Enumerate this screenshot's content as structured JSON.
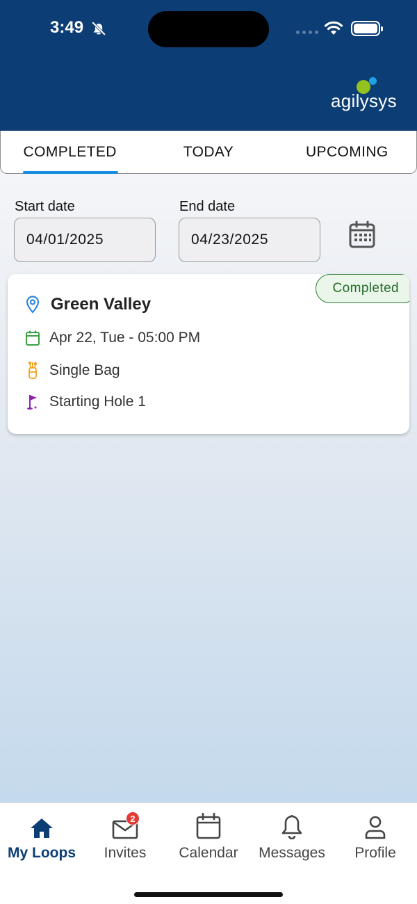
{
  "status_bar": {
    "time": "3:49"
  },
  "brand": {
    "name": "agilysys",
    "green": "#93c21f",
    "blue": "#1ea2e5",
    "header_color": "#0c3d75"
  },
  "tabs": [
    {
      "label": "COMPLETED",
      "active": true
    },
    {
      "label": "TODAY",
      "active": false
    },
    {
      "label": "UPCOMING",
      "active": false
    }
  ],
  "filters": {
    "start_label": "Start date",
    "start_value": "04/01/2025",
    "end_label": "End date",
    "end_value": "04/23/2025",
    "calendar_icon": "calendar-icon"
  },
  "loops": [
    {
      "status": "Completed",
      "course": "Green Valley",
      "datetime": "Apr 22, Tue - 05:00 PM",
      "bag": "Single Bag",
      "hole": "Starting Hole 1"
    }
  ],
  "bottom_nav": {
    "items": [
      {
        "label": "My Loops",
        "icon": "home-icon",
        "active": true
      },
      {
        "label": "Invites",
        "icon": "mail-icon",
        "badge": "2"
      },
      {
        "label": "Calendar",
        "icon": "calendar-icon"
      },
      {
        "label": "Messages",
        "icon": "bell-icon"
      },
      {
        "label": "Profile",
        "icon": "person-icon"
      }
    ]
  }
}
